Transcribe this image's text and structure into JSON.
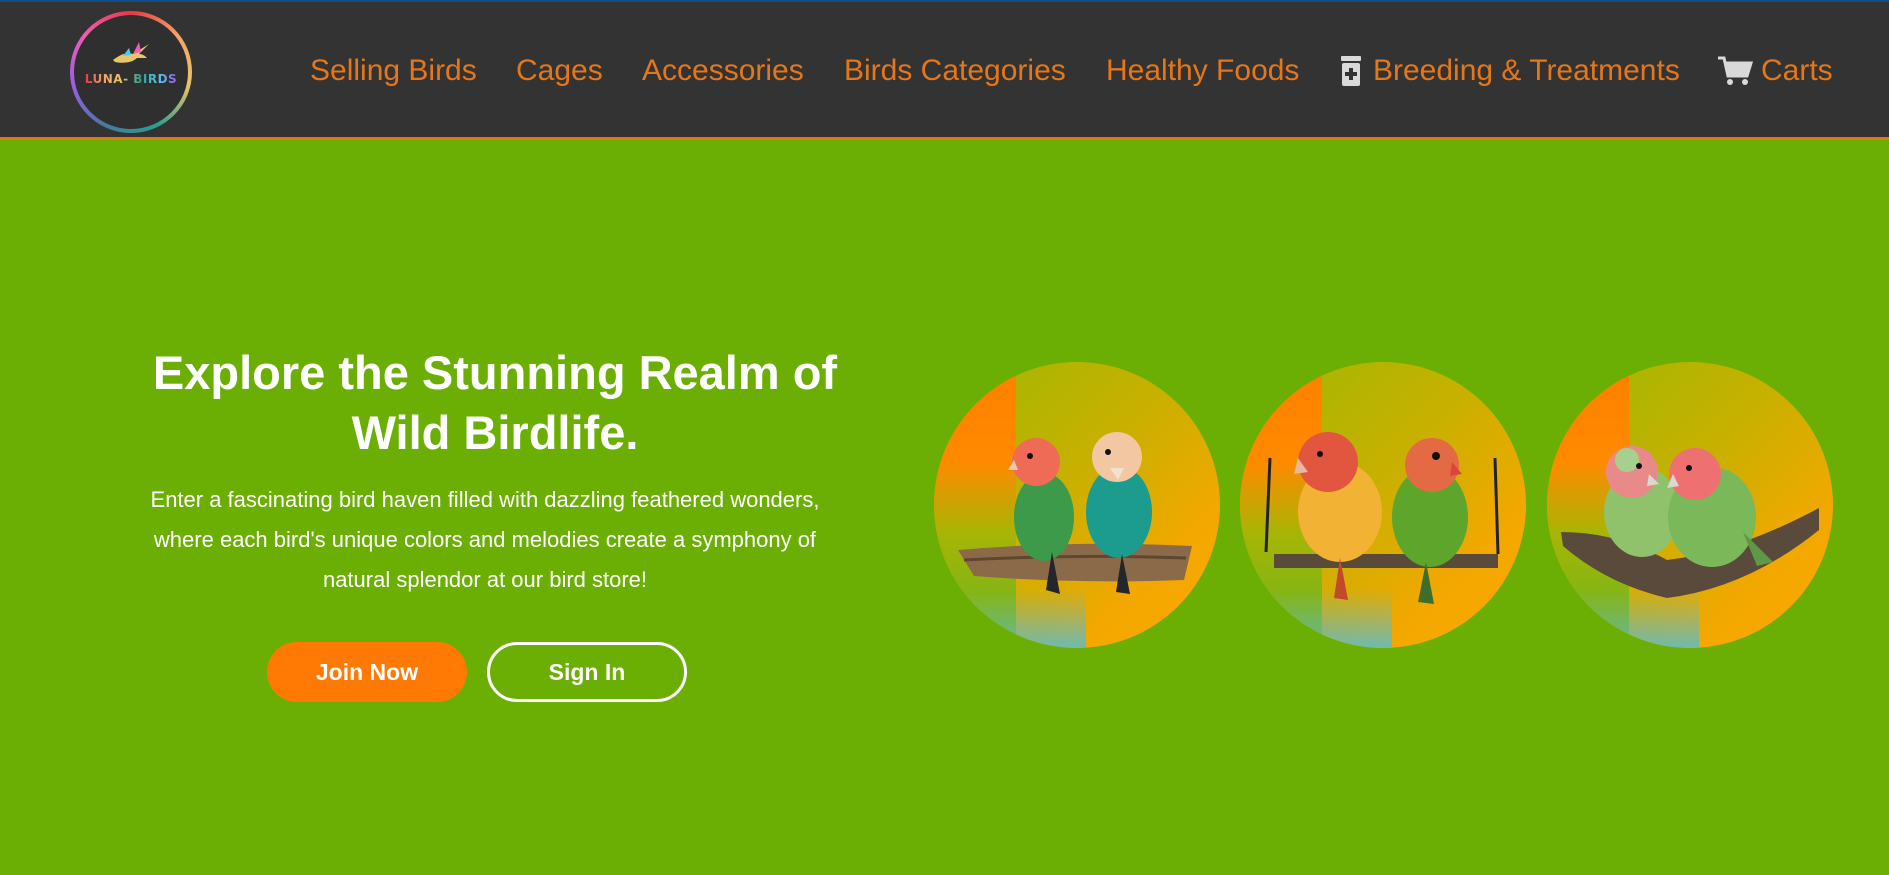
{
  "brand": {
    "logo_text": "LUNA- BIRDS"
  },
  "nav": {
    "items": [
      {
        "label": "Selling Birds",
        "icon": null
      },
      {
        "label": "Cages",
        "icon": null
      },
      {
        "label": "Accessories",
        "icon": null
      },
      {
        "label": "Birds Categories",
        "icon": null
      },
      {
        "label": "Healthy Foods",
        "icon": null
      },
      {
        "label": "Breeding & Treatments",
        "icon": "medicine-bottle-icon"
      },
      {
        "label": "Carts",
        "icon": "cart-icon"
      }
    ]
  },
  "hero": {
    "title": "Explore the Stunning Realm of Wild Birdlife.",
    "description": "Enter a fascinating bird haven filled with dazzling feathered wonders, where each bird's unique colors and melodies create a symphony of natural splendor at our bird store!",
    "join_label": "Join Now",
    "signin_label": "Sign In"
  },
  "gallery": {
    "images": [
      {
        "name": "lovebirds-perched-on-branch"
      },
      {
        "name": "lovebirds-on-swing"
      },
      {
        "name": "lovebirds-cuddling-on-branch"
      }
    ]
  },
  "colors": {
    "background": "#6caf04",
    "navbar": "#333333",
    "nav_text": "#e5771a",
    "accent": "#ff7a05",
    "text": "#ffffff"
  }
}
